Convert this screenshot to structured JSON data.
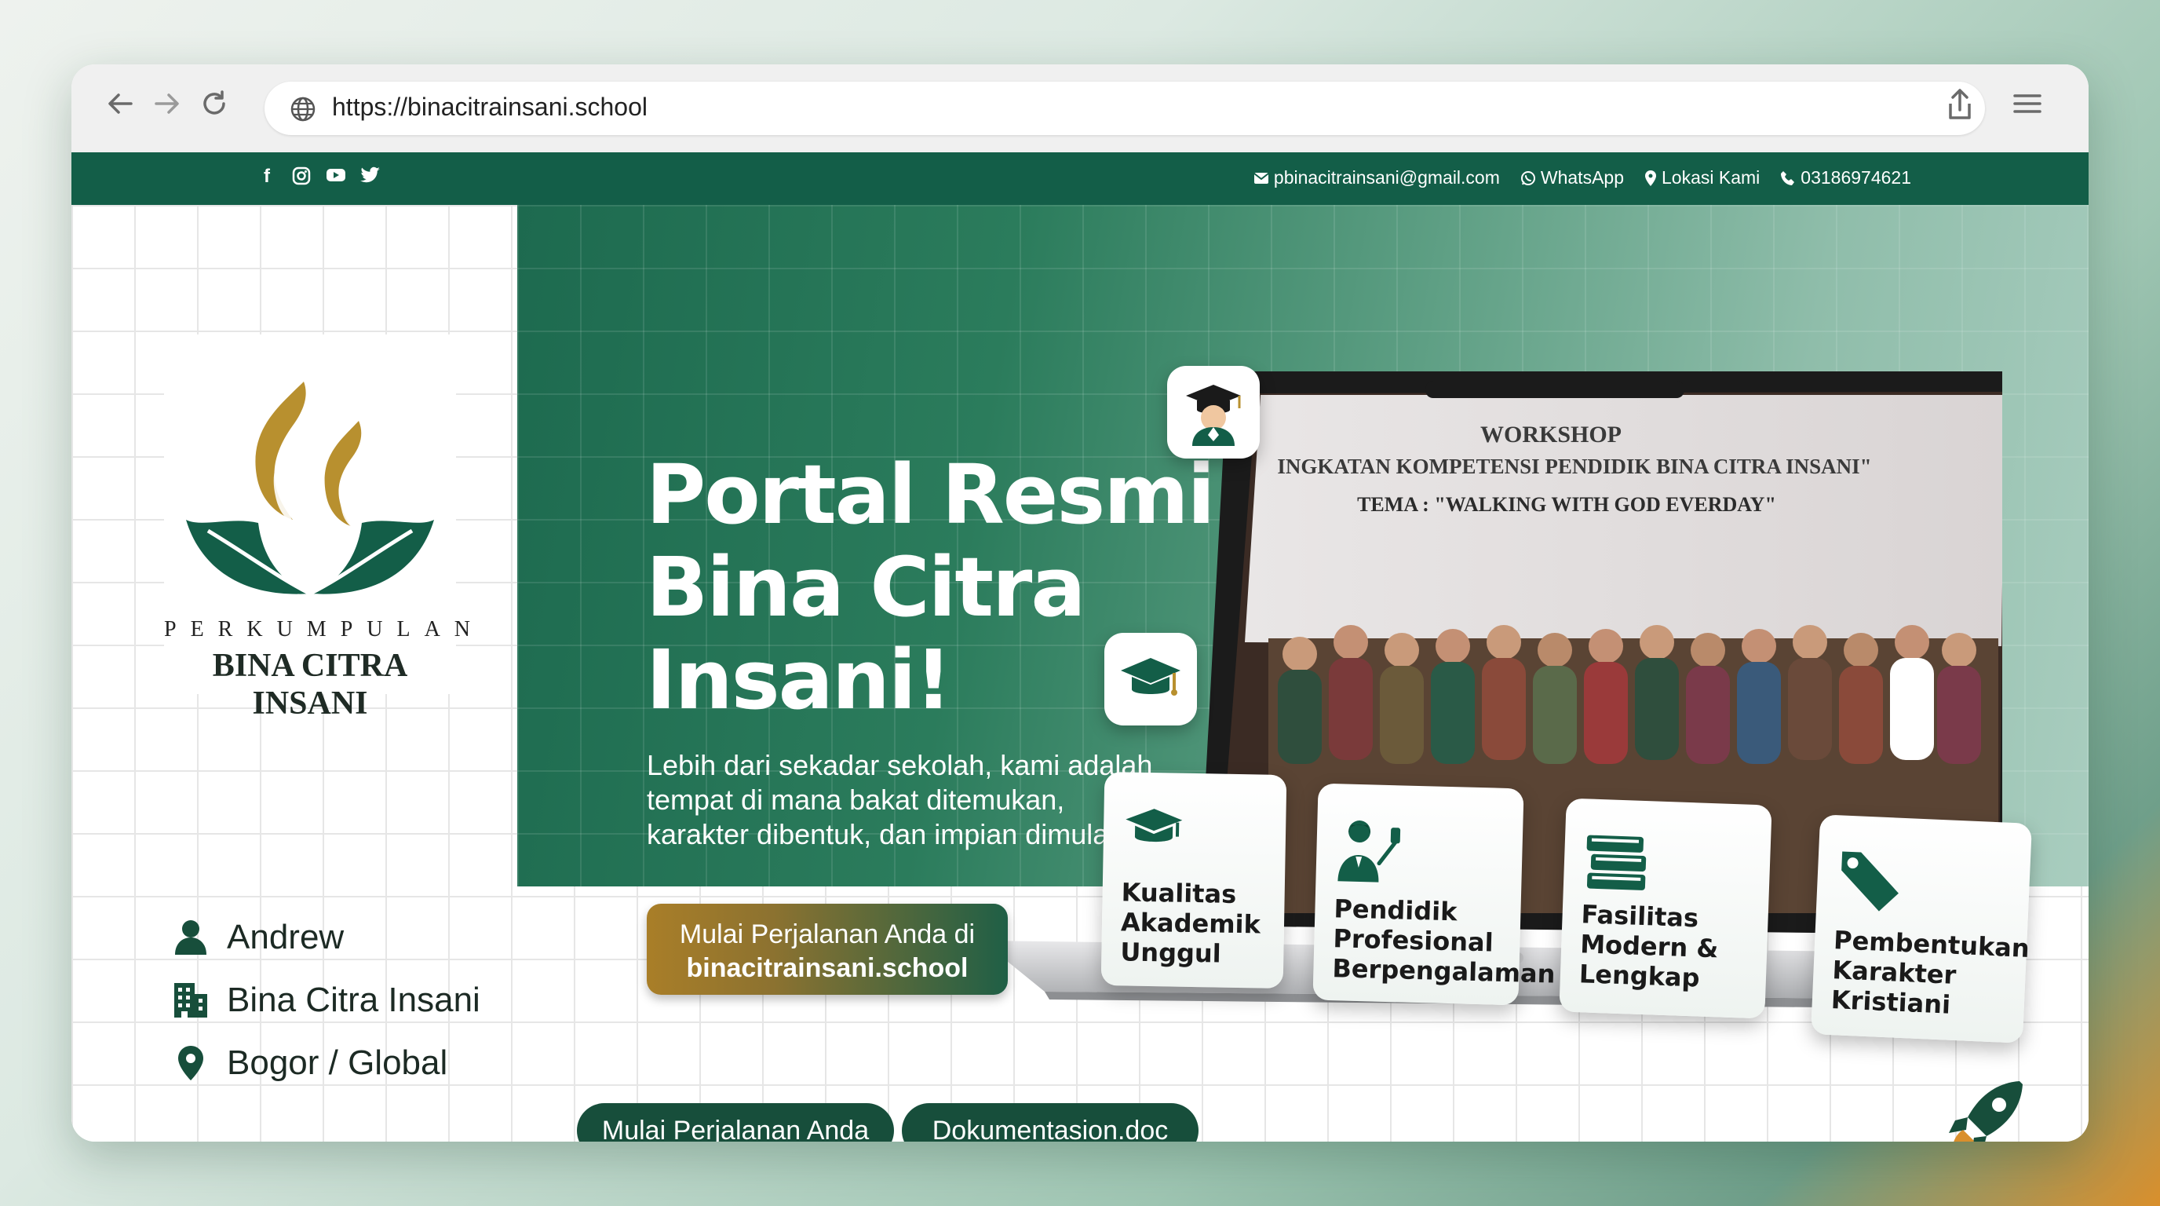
{
  "browser": {
    "url": "https://binacitrainsani.school",
    "back_icon": "arrow-left-icon",
    "forward_icon": "arrow-right-icon",
    "reload_icon": "reload-icon",
    "share_icon": "share-icon",
    "menu_icon": "hamburger-menu-icon"
  },
  "topbar": {
    "social_icons": [
      "facebook-icon",
      "instagram-icon",
      "youtube-icon",
      "twitter-icon"
    ],
    "email": "pbinacitrainsani@gmail.com",
    "whatsapp": "WhatsApp",
    "location": "Lokasi Kami",
    "phone": "03186974621"
  },
  "brand": {
    "org_small": "PERKUMPULAN",
    "org_big": "BINA CITRA INSANI",
    "colors": {
      "green": "#135e48",
      "gold": "#b8902f"
    }
  },
  "profile": {
    "name": "Andrew",
    "institution": "Bina Citra Insani",
    "location": "Bogor / Global"
  },
  "hero": {
    "title": "Portal Resmi Bina Citra Insani!",
    "subtitle": "Lebih dari sekadar sekolah, kami adalah tempat di mana bakat ditemukan, karakter dibentuk, dan impian dimulai.",
    "cta_line1": "Mulai Perjalanan Anda di",
    "cta_line2": "binacitrainsani.school"
  },
  "pills": {
    "start": "Mulai Perjalanan Anda",
    "doc": "Dokumentasion.doc"
  },
  "laptop_photo": {
    "banner_line1": "WORKSHOP",
    "banner_line2": "INGKATAN KOMPETENSI PENDIDIK BINA CITRA INSANI\"",
    "banner_line3": "TEMA : \"WALKING WITH GOD EVERDAY\""
  },
  "features": [
    {
      "label": "Kualitas Akademik Unggul",
      "icon": "graduation-cap-icon"
    },
    {
      "label": "Pendidik Profesional Berpengalaman",
      "icon": "teacher-icon"
    },
    {
      "label": "Fasilitas Modern & Lengkap",
      "icon": "books-icon"
    },
    {
      "label": "Pembentukan Karakter Kristiani",
      "icon": "tag-icon"
    }
  ]
}
